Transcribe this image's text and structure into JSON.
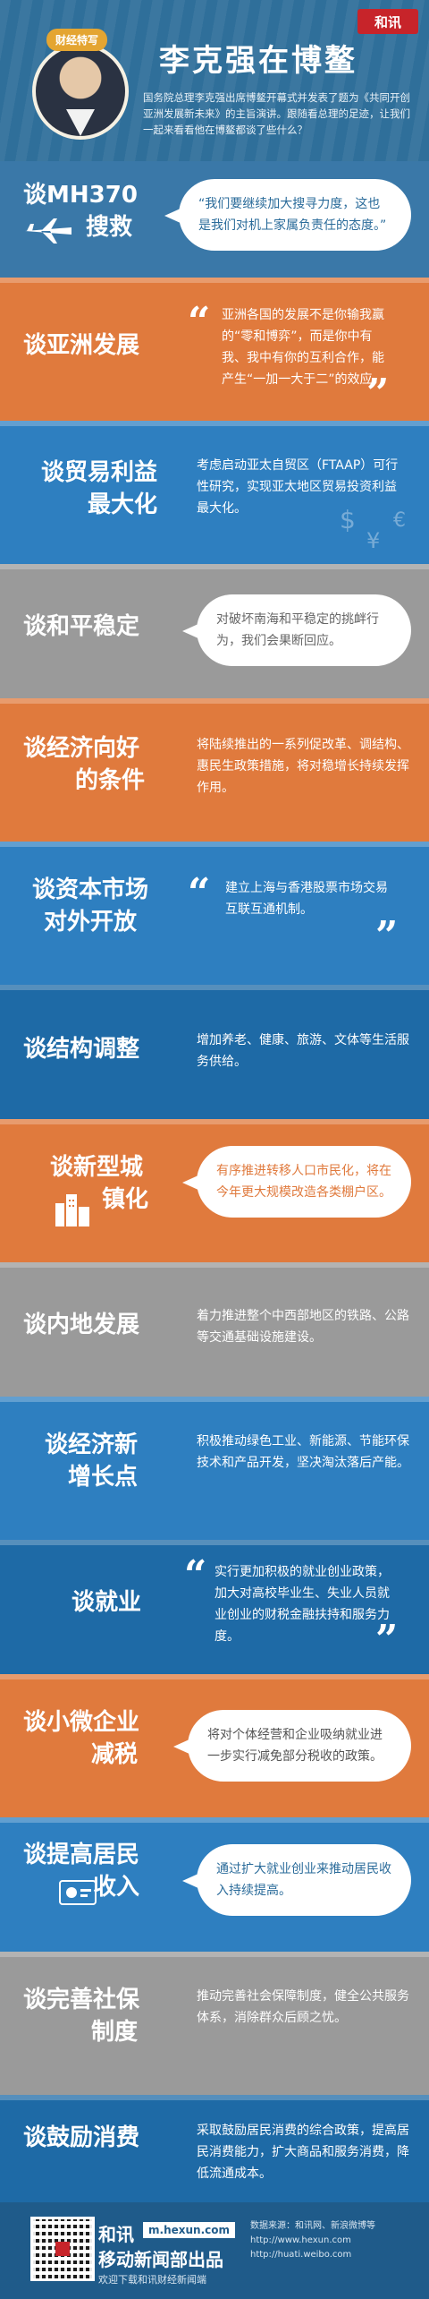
{
  "brand": {
    "logo_text": "和讯"
  },
  "header": {
    "badge": "财经特写",
    "title": "李克强在博鳌",
    "intro": "国务院总理李克强出席博鳌开幕式并发表了题为《共同开创亚洲发展新未来》的主旨演讲。跟随看总理的足迹，让我们一起来看看他在博鳌都谈了些什么？"
  },
  "sections": [
    {
      "label_line1": "谈MH370",
      "label_line2": "搜救",
      "text": "“我们要继续加大搜寻力度，这也是我们对机上家属负责任的态度。”",
      "color": "#3a78a8"
    },
    {
      "label_line1": "谈亚洲发展",
      "text": "亚洲各国的发展不是你输我赢的“零和博弈”，而是你中有我、我中有你的互利合作，能产生“一加一大于二”的效应。",
      "color": "#e07a3d"
    },
    {
      "label_line1": "谈贸易利益",
      "label_line2": "最大化",
      "text": "考虑启动亚太自贸区（FTAAP）可行性研究，实现亚太地区贸易投资利益最大化。",
      "color": "#2e7fc0"
    },
    {
      "label_line1": "谈和平稳定",
      "text": "对破坏南海和平稳定的挑衅行为，我们会果断回应。",
      "color": "#9a9a9a"
    },
    {
      "label_line1": "谈经济向好",
      "label_line2": "的条件",
      "text": "将陆续推出的一系列促改革、调结构、惠民生政策措施，将对稳增长持续发挥作用。",
      "color": "#e07a3d"
    },
    {
      "label_line1": "谈资本市场",
      "label_line2": "对外开放",
      "text": "建立上海与香港股票市场交易互联互通机制。",
      "color": "#2e7fc0"
    },
    {
      "label_line1": "谈结构调整",
      "text": "增加养老、健康、旅游、文体等生活服务供给。",
      "color": "#1e6aa6"
    },
    {
      "label_line1": "谈新型城",
      "label_line2": "镇化",
      "text": "有序推进转移人口市民化，将在今年更大规模改造各类棚户区。",
      "color": "#e07a3d"
    },
    {
      "label_line1": "谈内地发展",
      "text": "着力推进整个中西部地区的铁路、公路等交通基础设施建设。",
      "color": "#9a9a9a"
    },
    {
      "label_line1": "谈经济新",
      "label_line2": "增长点",
      "text": "积极推动绿色工业、新能源、节能环保技术和产品开发，坚决淘汰落后产能。",
      "color": "#2e7fc0"
    },
    {
      "label_line1": "谈就业",
      "text": "实行更加积极的就业创业政策，加大对高校毕业生、失业人员就业创业的财税金融扶持和服务力度。",
      "color": "#1e6aa6"
    },
    {
      "label_line1": "谈小微企业",
      "label_line2": "减税",
      "text": "将对个体经营和企业吸纳就业进一步实行减免部分税收的政策。",
      "color": "#e07a3d"
    },
    {
      "label_line1": "谈提高居民",
      "label_line2": "收入",
      "text": "通过扩大就业创业来推动居民收入持续提高。",
      "color": "#2e7fc0"
    },
    {
      "label_line1": "谈完善社保",
      "label_line2": "制度",
      "text": "推动完善社会保障制度，健全公共服务体系，消除群众后顾之忧。",
      "color": "#9a9a9a"
    },
    {
      "label_line1": "谈鼓励消费",
      "text": "采取鼓励居民消费的综合政策，提高居民消费能力，扩大商品和服务消费，降低流通成本。",
      "color": "#1e6aa6"
    }
  ],
  "quote_marks": {
    "open": "“",
    "close": "”"
  },
  "footer": {
    "brand": "和讯",
    "url": "m.hexun.com",
    "sub": "移动新闻部出品",
    "tagline": "欢迎下载和讯财经新闻端",
    "source_label": "数据来源：和讯网、新浪微博等",
    "site1": "http://www.hexun.com",
    "site2": "http://huati.weibo.com"
  }
}
